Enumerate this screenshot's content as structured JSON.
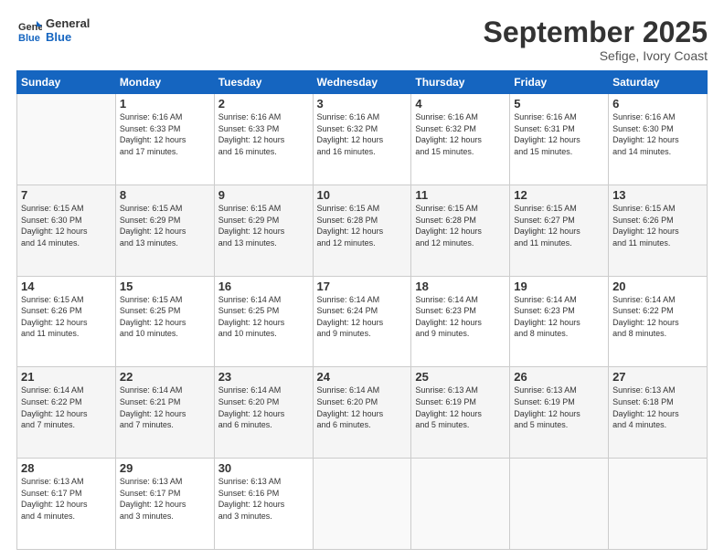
{
  "logo": {
    "line1": "General",
    "line2": "Blue"
  },
  "title": "September 2025",
  "location": "Sefige, Ivory Coast",
  "headers": [
    "Sunday",
    "Monday",
    "Tuesday",
    "Wednesday",
    "Thursday",
    "Friday",
    "Saturday"
  ],
  "weeks": [
    [
      {
        "day": "",
        "info": ""
      },
      {
        "day": "1",
        "info": "Sunrise: 6:16 AM\nSunset: 6:33 PM\nDaylight: 12 hours\nand 17 minutes."
      },
      {
        "day": "2",
        "info": "Sunrise: 6:16 AM\nSunset: 6:33 PM\nDaylight: 12 hours\nand 16 minutes."
      },
      {
        "day": "3",
        "info": "Sunrise: 6:16 AM\nSunset: 6:32 PM\nDaylight: 12 hours\nand 16 minutes."
      },
      {
        "day": "4",
        "info": "Sunrise: 6:16 AM\nSunset: 6:32 PM\nDaylight: 12 hours\nand 15 minutes."
      },
      {
        "day": "5",
        "info": "Sunrise: 6:16 AM\nSunset: 6:31 PM\nDaylight: 12 hours\nand 15 minutes."
      },
      {
        "day": "6",
        "info": "Sunrise: 6:16 AM\nSunset: 6:30 PM\nDaylight: 12 hours\nand 14 minutes."
      }
    ],
    [
      {
        "day": "7",
        "info": "Sunrise: 6:15 AM\nSunset: 6:30 PM\nDaylight: 12 hours\nand 14 minutes."
      },
      {
        "day": "8",
        "info": "Sunrise: 6:15 AM\nSunset: 6:29 PM\nDaylight: 12 hours\nand 13 minutes."
      },
      {
        "day": "9",
        "info": "Sunrise: 6:15 AM\nSunset: 6:29 PM\nDaylight: 12 hours\nand 13 minutes."
      },
      {
        "day": "10",
        "info": "Sunrise: 6:15 AM\nSunset: 6:28 PM\nDaylight: 12 hours\nand 12 minutes."
      },
      {
        "day": "11",
        "info": "Sunrise: 6:15 AM\nSunset: 6:28 PM\nDaylight: 12 hours\nand 12 minutes."
      },
      {
        "day": "12",
        "info": "Sunrise: 6:15 AM\nSunset: 6:27 PM\nDaylight: 12 hours\nand 11 minutes."
      },
      {
        "day": "13",
        "info": "Sunrise: 6:15 AM\nSunset: 6:26 PM\nDaylight: 12 hours\nand 11 minutes."
      }
    ],
    [
      {
        "day": "14",
        "info": "Sunrise: 6:15 AM\nSunset: 6:26 PM\nDaylight: 12 hours\nand 11 minutes."
      },
      {
        "day": "15",
        "info": "Sunrise: 6:15 AM\nSunset: 6:25 PM\nDaylight: 12 hours\nand 10 minutes."
      },
      {
        "day": "16",
        "info": "Sunrise: 6:14 AM\nSunset: 6:25 PM\nDaylight: 12 hours\nand 10 minutes."
      },
      {
        "day": "17",
        "info": "Sunrise: 6:14 AM\nSunset: 6:24 PM\nDaylight: 12 hours\nand 9 minutes."
      },
      {
        "day": "18",
        "info": "Sunrise: 6:14 AM\nSunset: 6:23 PM\nDaylight: 12 hours\nand 9 minutes."
      },
      {
        "day": "19",
        "info": "Sunrise: 6:14 AM\nSunset: 6:23 PM\nDaylight: 12 hours\nand 8 minutes."
      },
      {
        "day": "20",
        "info": "Sunrise: 6:14 AM\nSunset: 6:22 PM\nDaylight: 12 hours\nand 8 minutes."
      }
    ],
    [
      {
        "day": "21",
        "info": "Sunrise: 6:14 AM\nSunset: 6:22 PM\nDaylight: 12 hours\nand 7 minutes."
      },
      {
        "day": "22",
        "info": "Sunrise: 6:14 AM\nSunset: 6:21 PM\nDaylight: 12 hours\nand 7 minutes."
      },
      {
        "day": "23",
        "info": "Sunrise: 6:14 AM\nSunset: 6:20 PM\nDaylight: 12 hours\nand 6 minutes."
      },
      {
        "day": "24",
        "info": "Sunrise: 6:14 AM\nSunset: 6:20 PM\nDaylight: 12 hours\nand 6 minutes."
      },
      {
        "day": "25",
        "info": "Sunrise: 6:13 AM\nSunset: 6:19 PM\nDaylight: 12 hours\nand 5 minutes."
      },
      {
        "day": "26",
        "info": "Sunrise: 6:13 AM\nSunset: 6:19 PM\nDaylight: 12 hours\nand 5 minutes."
      },
      {
        "day": "27",
        "info": "Sunrise: 6:13 AM\nSunset: 6:18 PM\nDaylight: 12 hours\nand 4 minutes."
      }
    ],
    [
      {
        "day": "28",
        "info": "Sunrise: 6:13 AM\nSunset: 6:17 PM\nDaylight: 12 hours\nand 4 minutes."
      },
      {
        "day": "29",
        "info": "Sunrise: 6:13 AM\nSunset: 6:17 PM\nDaylight: 12 hours\nand 3 minutes."
      },
      {
        "day": "30",
        "info": "Sunrise: 6:13 AM\nSunset: 6:16 PM\nDaylight: 12 hours\nand 3 minutes."
      },
      {
        "day": "",
        "info": ""
      },
      {
        "day": "",
        "info": ""
      },
      {
        "day": "",
        "info": ""
      },
      {
        "day": "",
        "info": ""
      }
    ]
  ]
}
